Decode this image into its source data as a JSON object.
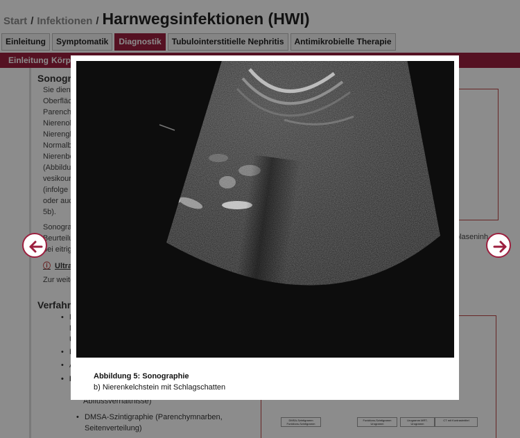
{
  "breadcrumb": {
    "start": "Start",
    "sep1": "/",
    "infektionen": "Infektionen",
    "sep2": "/",
    "title": "Harnwegsinfektionen (HWI)"
  },
  "tabs": [
    {
      "label": "Einleitung"
    },
    {
      "label": "Symptomatik"
    },
    {
      "label": "Diagnostik"
    },
    {
      "label": "Tubulointerstitielle Nephritis"
    },
    {
      "label": "Antimikrobielle Therapie"
    }
  ],
  "subnav": {
    "item1": "Einleitung",
    "item2": "Körpe"
  },
  "content": {
    "section1_head": "Sonogra",
    "para1_lines": [
      "Sie dient",
      "Oberfläc",
      "Parench",
      "Nierenob",
      "Nierengl",
      "Normalb",
      "Nierenbe",
      "(Abbildu",
      "vesikour",
      "(infolge N",
      "oder auc",
      "5b)."
    ],
    "para2_lines": [
      "Sonogra",
      "Beurteilu",
      "bei eitrig"
    ],
    "right_fragment": "blaseninh",
    "ultra_link": "Ultra",
    "zur_weite": "Zur weite",
    "section2_head": "Verfahre",
    "bullet1_lines": [
      "M",
      "M",
      "U"
    ],
    "bullet2": "K",
    "bullet3": "A",
    "bullet4": "N",
    "abfluss": "Abflussverhältnisse)",
    "dmsa_line1": "DMSA-Szintigraphie (Parenchymnarben,",
    "dmsa_line2": "Seitenverteilung)"
  },
  "flowchart": {
    "box1": "DMSA-Szintigramm Funktions-Szintigramm",
    "box2": "Funktions-Szintigramm Urogramm",
    "box3": "Urogramm MRT-Urogramm",
    "box4": "CT mit Kontrastmittel"
  },
  "lightbox": {
    "caption_title": "Abbildung 5: Sonographie",
    "caption_sub": "b) Nierenkelchstein mit Schlagschatten"
  },
  "colors": {
    "accent": "#9c1f3e",
    "overlay": "rgba(0,0,0,0.45)"
  },
  "icons": {
    "prev": "arrow-left-icon",
    "next": "arrow-right-icon"
  }
}
